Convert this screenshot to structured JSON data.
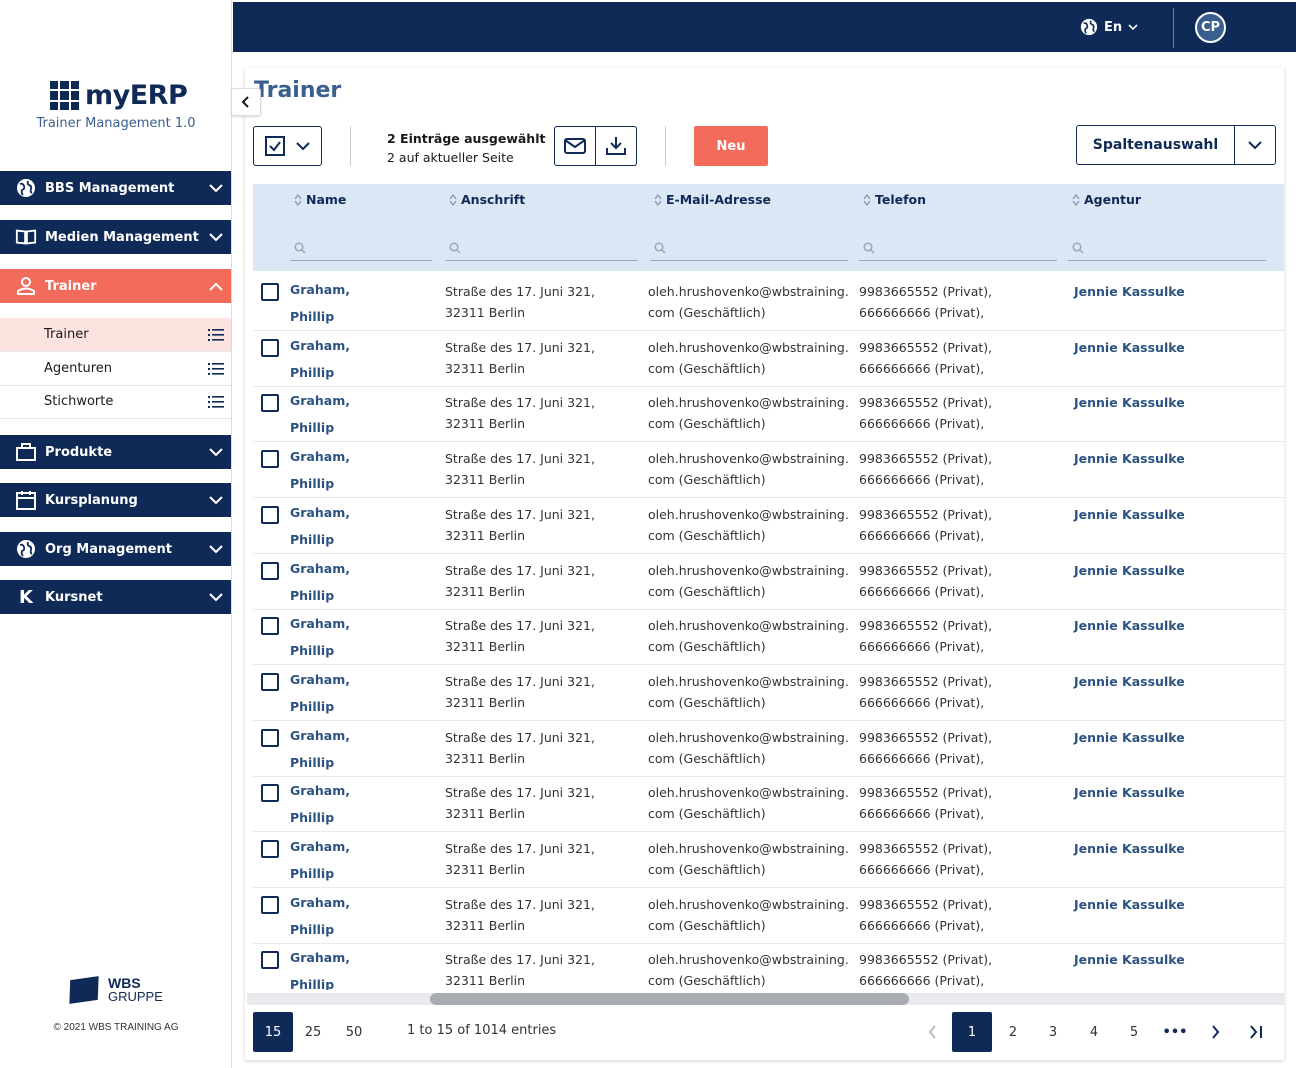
{
  "app": {
    "logo_text": "myERP",
    "subtitle": "Trainer Management 1.0"
  },
  "sidebar": {
    "main_items": [
      {
        "label": "BBS Management",
        "icon": "globe-icon"
      },
      {
        "label": "Medien Management",
        "icon": "book-icon"
      },
      {
        "label": "Trainer",
        "icon": "person-icon"
      },
      {
        "label": "Produkte",
        "icon": "briefcase-icon"
      },
      {
        "label": "Kursplanung",
        "icon": "calendar-icon"
      },
      {
        "label": "Org Management",
        "icon": "globe-icon"
      },
      {
        "label": "Kursnet",
        "icon": "k-icon"
      }
    ],
    "sub_items": [
      {
        "label": "Trainer"
      },
      {
        "label": "Agenturen"
      },
      {
        "label": "Stichworte"
      }
    ],
    "footer_brand_line1": "WBS",
    "footer_brand_line2": "GRUPPE",
    "copyright": "© 2021 WBS TRAINING AG"
  },
  "topbar": {
    "language": "En",
    "avatar_initials": "CP"
  },
  "page": {
    "title": "Trainer",
    "selection_line1": "2 Einträge ausgewählt",
    "selection_line2": "2 auf aktueller Seite",
    "new_button": "Neu",
    "columns_button": "Spaltenauswahl"
  },
  "table": {
    "headers": [
      "Name",
      "Anschrift",
      "E-Mail-Adresse",
      "Telefon",
      "Agentur"
    ],
    "rows": [
      {
        "name1": "Graham,",
        "name2": "Phillip",
        "addr1": "Straße des 17. Juni 321,",
        "addr2": "32311 Berlin",
        "mail1": "oleh.hrushovenko@wbstraining.",
        "mail2": "com (Geschäftlich)",
        "tel1": "9983665552 (Privat),",
        "tel2": "666666666 (Privat),",
        "agent": "Jennie Kassulke"
      },
      {
        "name1": "Graham,",
        "name2": "Phillip",
        "addr1": "Straße des 17. Juni 321,",
        "addr2": "32311 Berlin",
        "mail1": "oleh.hrushovenko@wbstraining.",
        "mail2": "com (Geschäftlich)",
        "tel1": "9983665552 (Privat),",
        "tel2": "666666666 (Privat),",
        "agent": "Jennie Kassulke"
      },
      {
        "name1": "Graham,",
        "name2": "Phillip",
        "addr1": "Straße des 17. Juni 321,",
        "addr2": "32311 Berlin",
        "mail1": "oleh.hrushovenko@wbstraining.",
        "mail2": "com (Geschäftlich)",
        "tel1": "9983665552 (Privat),",
        "tel2": "666666666 (Privat),",
        "agent": "Jennie Kassulke"
      },
      {
        "name1": "Graham,",
        "name2": "Phillip",
        "addr1": "Straße des 17. Juni 321,",
        "addr2": "32311 Berlin",
        "mail1": "oleh.hrushovenko@wbstraining.",
        "mail2": "com (Geschäftlich)",
        "tel1": "9983665552 (Privat),",
        "tel2": "666666666 (Privat),",
        "agent": "Jennie Kassulke"
      },
      {
        "name1": "Graham,",
        "name2": "Phillip",
        "addr1": "Straße des 17. Juni 321,",
        "addr2": "32311 Berlin",
        "mail1": "oleh.hrushovenko@wbstraining.",
        "mail2": "com (Geschäftlich)",
        "tel1": "9983665552 (Privat),",
        "tel2": "666666666 (Privat),",
        "agent": "Jennie Kassulke"
      },
      {
        "name1": "Graham,",
        "name2": "Phillip",
        "addr1": "Straße des 17. Juni 321,",
        "addr2": "32311 Berlin",
        "mail1": "oleh.hrushovenko@wbstraining.",
        "mail2": "com (Geschäftlich)",
        "tel1": "9983665552 (Privat),",
        "tel2": "666666666 (Privat),",
        "agent": "Jennie Kassulke"
      },
      {
        "name1": "Graham,",
        "name2": "Phillip",
        "addr1": "Straße des 17. Juni 321,",
        "addr2": "32311 Berlin",
        "mail1": "oleh.hrushovenko@wbstraining.",
        "mail2": "com (Geschäftlich)",
        "tel1": "9983665552 (Privat),",
        "tel2": "666666666 (Privat),",
        "agent": "Jennie Kassulke"
      },
      {
        "name1": "Graham,",
        "name2": "Phillip",
        "addr1": "Straße des 17. Juni 321,",
        "addr2": "32311 Berlin",
        "mail1": "oleh.hrushovenko@wbstraining.",
        "mail2": "com (Geschäftlich)",
        "tel1": "9983665552 (Privat),",
        "tel2": "666666666 (Privat),",
        "agent": "Jennie Kassulke"
      },
      {
        "name1": "Graham,",
        "name2": "Phillip",
        "addr1": "Straße des 17. Juni 321,",
        "addr2": "32311 Berlin",
        "mail1": "oleh.hrushovenko@wbstraining.",
        "mail2": "com (Geschäftlich)",
        "tel1": "9983665552 (Privat),",
        "tel2": "666666666 (Privat),",
        "agent": "Jennie Kassulke"
      },
      {
        "name1": "Graham,",
        "name2": "Phillip",
        "addr1": "Straße des 17. Juni 321,",
        "addr2": "32311 Berlin",
        "mail1": "oleh.hrushovenko@wbstraining.",
        "mail2": "com (Geschäftlich)",
        "tel1": "9983665552 (Privat),",
        "tel2": "666666666 (Privat),",
        "agent": "Jennie Kassulke"
      },
      {
        "name1": "Graham,",
        "name2": "Phillip",
        "addr1": "Straße des 17. Juni 321,",
        "addr2": "32311 Berlin",
        "mail1": "oleh.hrushovenko@wbstraining.",
        "mail2": "com (Geschäftlich)",
        "tel1": "9983665552 (Privat),",
        "tel2": "666666666 (Privat),",
        "agent": "Jennie Kassulke"
      },
      {
        "name1": "Graham,",
        "name2": "Phillip",
        "addr1": "Straße des 17. Juni 321,",
        "addr2": "32311 Berlin",
        "mail1": "oleh.hrushovenko@wbstraining.",
        "mail2": "com (Geschäftlich)",
        "tel1": "9983665552 (Privat),",
        "tel2": "666666666 (Privat),",
        "agent": "Jennie Kassulke"
      },
      {
        "name1": "Graham,",
        "name2": "Phillip",
        "addr1": "Straße des 17. Juni 321,",
        "addr2": "32311 Berlin",
        "mail1": "oleh.hrushovenko@wbstraining.",
        "mail2": "com (Geschäftlich)",
        "tel1": "9983665552 (Privat),",
        "tel2": "666666666 (Privat),",
        "agent": "Jennie Kassulke"
      }
    ]
  },
  "footer": {
    "page_sizes": [
      "15",
      "25",
      "50"
    ],
    "entries_text": "1 to 15 of 1014 entries",
    "pages": [
      "1",
      "2",
      "3",
      "4",
      "5"
    ],
    "ellipsis": "•••"
  },
  "colors": {
    "navy": "#0f2a57",
    "accent": "#f26b5b",
    "header_bg": "#dbe7f5"
  }
}
